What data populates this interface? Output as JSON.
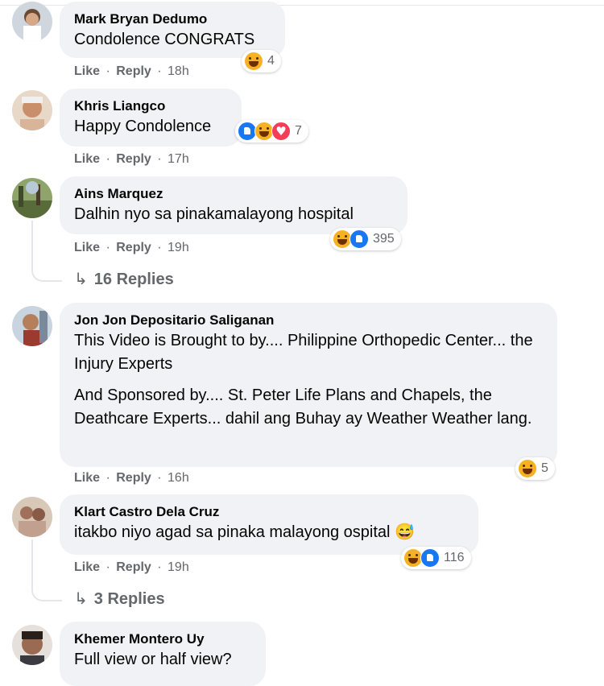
{
  "colors": {
    "bubble_bg": "#f0f2f5",
    "secondary_text": "#65676b",
    "like_blue": "#1877f2",
    "haha_yellow": "#f7b125",
    "love_red": "#f33e58"
  },
  "action_like": "Like",
  "action_reply": "Reply",
  "comments": [
    {
      "author": "Mark Bryan Dedumo",
      "text": [
        "Condolence CONGRATS"
      ],
      "time": "18h",
      "reactions": [
        "haha"
      ],
      "reaction_count": "4"
    },
    {
      "author": "Khris Liangco",
      "text": [
        "Happy Condolence"
      ],
      "time": "17h",
      "reactions": [
        "like",
        "haha",
        "love"
      ],
      "reaction_count": "7"
    },
    {
      "author": "Ains Marquez",
      "text": [
        "Dalhin nyo sa pinakamalayong hospital"
      ],
      "time": "19h",
      "reactions": [
        "haha",
        "like"
      ],
      "reaction_count": "395",
      "replies_label": "16 Replies"
    },
    {
      "author": "Jon Jon Depositario Saliganan",
      "text": [
        "This Video is Brought to by.... Philippine Orthopedic Center... the Injury Experts",
        "And Sponsored by.... St. Peter Life Plans and Chapels, the Deathcare Experts... dahil ang Buhay ay Weather Weather lang."
      ],
      "time": "16h",
      "reactions": [
        "haha"
      ],
      "reaction_count": "5"
    },
    {
      "author": "Klart Castro Dela Cruz",
      "text": [
        "itakbo niyo agad sa pinaka malayong ospital 😅"
      ],
      "time": "19h",
      "reactions": [
        "haha",
        "like"
      ],
      "reaction_count": "116",
      "replies_label": "3 Replies"
    },
    {
      "author": "Khemer Montero Uy",
      "text": [
        "Full view or half view?"
      ]
    }
  ]
}
